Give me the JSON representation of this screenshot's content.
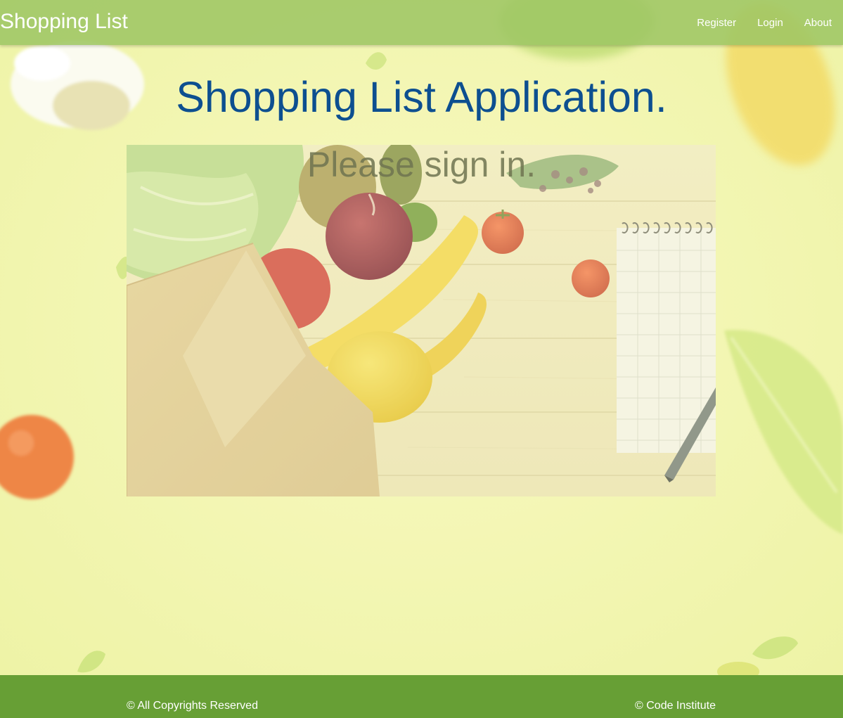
{
  "navbar": {
    "brand": "Shopping List",
    "links": [
      {
        "label": "Register"
      },
      {
        "label": "Login"
      },
      {
        "label": "About"
      }
    ]
  },
  "main": {
    "title": "Shopping List Application.",
    "subtitle": "Please sign in."
  },
  "footer": {
    "left": "© All Copyrights Reserved",
    "right": "© Code Institute"
  },
  "colors": {
    "navbar": "#9ec664",
    "footer": "#679f35",
    "title": "#0d4f90",
    "background": "#f6f7b4"
  }
}
